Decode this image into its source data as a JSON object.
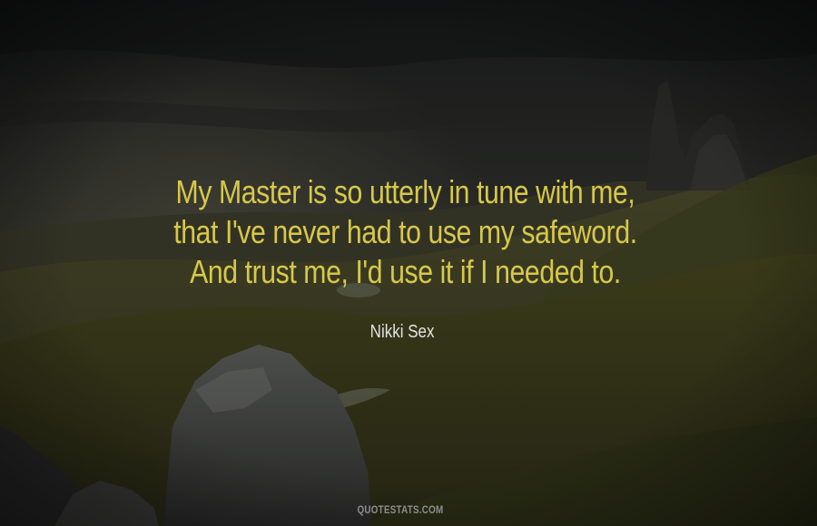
{
  "quote": {
    "lines": [
      "My Master is so utterly in tune with me,",
      "that I've never had to use my safeword.",
      "And trust me, I'd use it if I needed to."
    ]
  },
  "author": "Nikki Sex",
  "watermark": "QUOTESTATS.COM",
  "colors": {
    "quote_text": "#d7c84a",
    "author_text": "#e3e3e3",
    "watermark_text": "#8e8e8e"
  }
}
